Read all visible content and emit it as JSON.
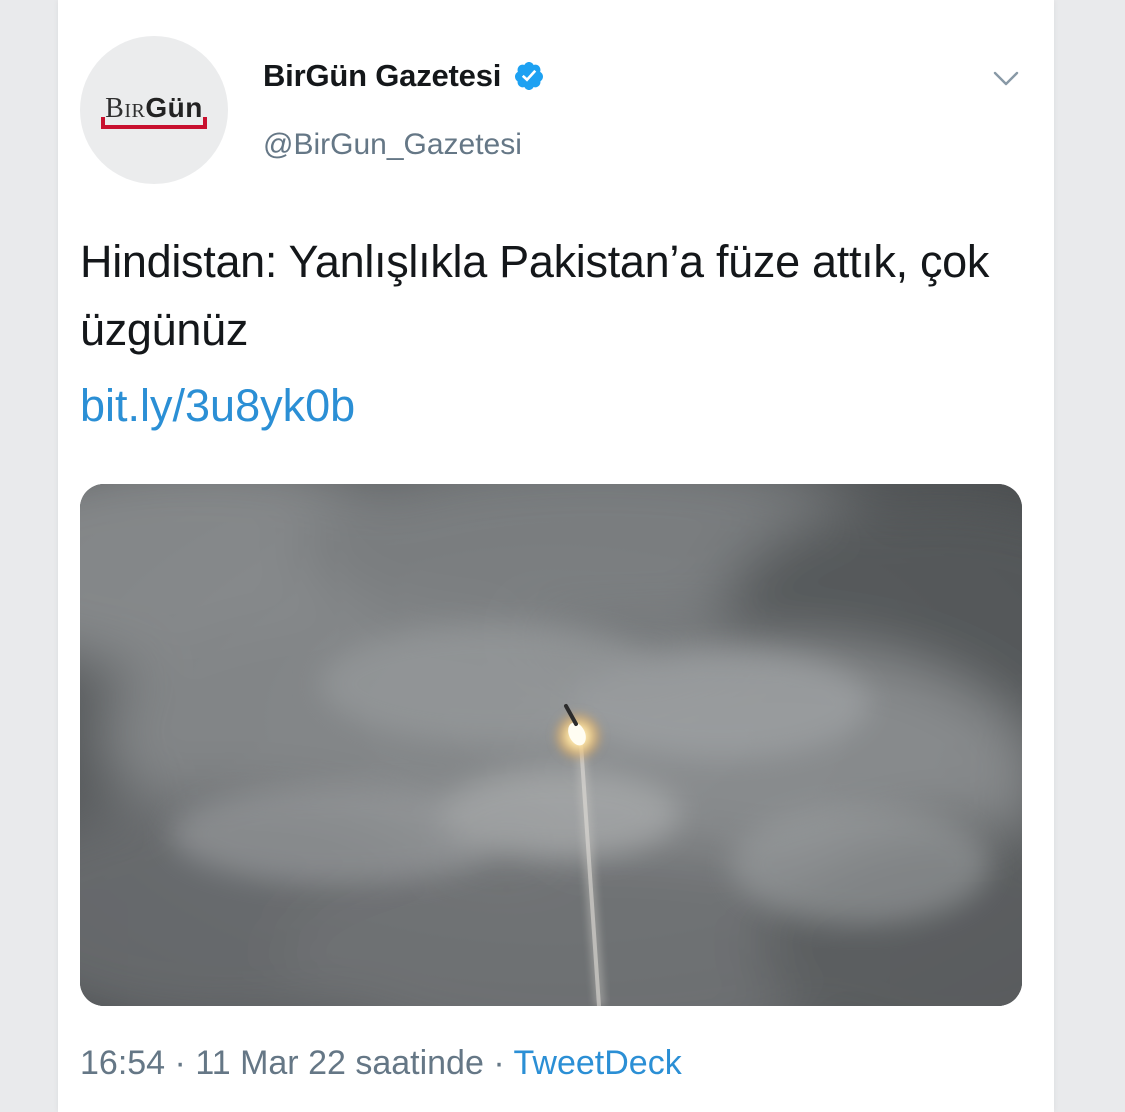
{
  "author": {
    "display_name": "BirGün Gazetesi",
    "handle": "@BirGun_Gazetesi",
    "verified": true,
    "avatar_logo": {
      "light": "Bir",
      "bold": "Gün"
    }
  },
  "tweet": {
    "text": "Hindistan: Yanlışlıkla Pakistan’a füze attık, çok üzgünüz",
    "link": "bit.ly/3u8yk0b",
    "time": "16:54",
    "separator": "·",
    "date": "11 Mar 22 saatinde",
    "source": "TweetDeck"
  },
  "icons": {
    "verified": "verified-badge-icon",
    "menu": "chevron-down-icon"
  },
  "colors": {
    "link": "#2b8fd5",
    "verified": "#1da1f2",
    "logo_accent": "#c8102e",
    "muted_text": "#657786"
  }
}
